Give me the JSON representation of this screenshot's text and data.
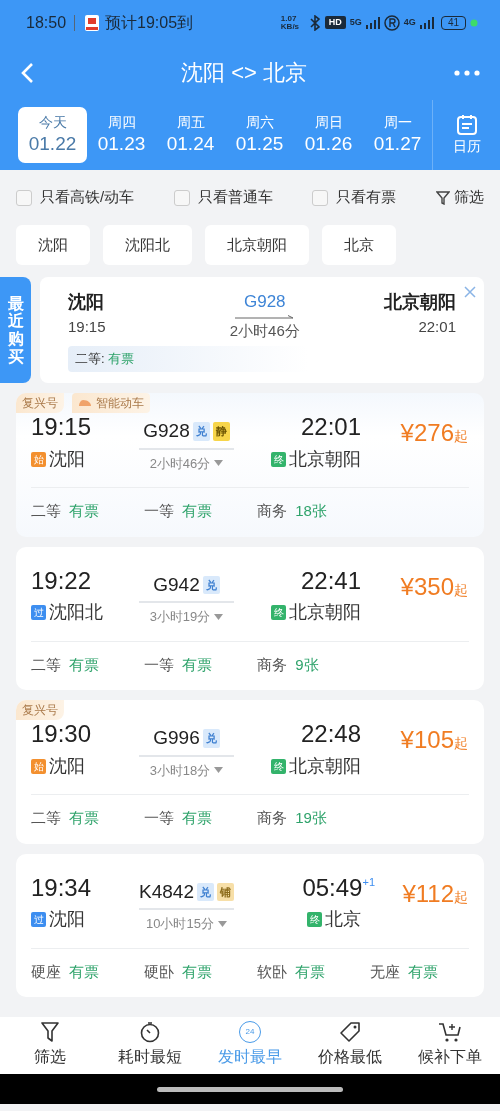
{
  "status_bar": {
    "time": "18:50",
    "notification": "预计19:05到",
    "net_speed": "1.07 KB/s",
    "hd": "HD",
    "network_1": "5G",
    "network_2": "4G",
    "battery": "41"
  },
  "header": {
    "title": "沈阳 <> 北京"
  },
  "dates": [
    {
      "weekday": "今天",
      "date": "01.22",
      "selected": true
    },
    {
      "weekday": "周四",
      "date": "01.23",
      "selected": false
    },
    {
      "weekday": "周五",
      "date": "01.24",
      "selected": false
    },
    {
      "weekday": "周六",
      "date": "01.25",
      "selected": false
    },
    {
      "weekday": "周日",
      "date": "01.26",
      "selected": false
    },
    {
      "weekday": "周一",
      "date": "01.27",
      "selected": false
    }
  ],
  "calendar": {
    "label": "日历"
  },
  "filters": [
    {
      "label": "只看高铁/动车",
      "checked": false
    },
    {
      "label": "只看普通车",
      "checked": false
    },
    {
      "label": "只看有票",
      "checked": false
    }
  ],
  "filter_button": {
    "label": "筛选"
  },
  "stations": [
    "沈阳",
    "沈阳北",
    "北京朝阳",
    "北京"
  ],
  "recent": {
    "tab": "最近购买",
    "from": "沈阳",
    "dep_time": "19:15",
    "train": "G928",
    "duration": "2小时46分",
    "to": "北京朝阳",
    "arr_time": "22:01",
    "seat_class": "二等:",
    "seat_status": "有票"
  },
  "trains": [
    {
      "tags": [
        {
          "label": "复兴号",
          "kind": "plain"
        },
        {
          "label": "智能动车",
          "kind": "smart"
        }
      ],
      "dep_time": "19:15",
      "dep_badge": {
        "text": "始",
        "kind": "start"
      },
      "dep_station": "沈阳",
      "number": "G928",
      "badges": [
        {
          "text": "兑",
          "kind": "exchange"
        },
        {
          "text": "静",
          "kind": "quiet"
        }
      ],
      "duration": "2小时46分",
      "arr_time": "22:01",
      "arr_badge": {
        "text": "终",
        "kind": "end"
      },
      "arr_station": "北京朝阳",
      "price": "¥276",
      "price_suffix": "起",
      "seats": [
        {
          "class": "二等",
          "status": "有票"
        },
        {
          "class": "一等",
          "status": "有票"
        },
        {
          "class": "商务",
          "status": "18张"
        }
      ]
    },
    {
      "dep_time": "19:22",
      "dep_badge": {
        "text": "过",
        "kind": "pass"
      },
      "dep_station": "沈阳北",
      "number": "G942",
      "badges": [
        {
          "text": "兑",
          "kind": "exchange"
        }
      ],
      "duration": "3小时19分",
      "arr_time": "22:41",
      "arr_badge": {
        "text": "终",
        "kind": "end"
      },
      "arr_station": "北京朝阳",
      "price": "¥350",
      "price_suffix": "起",
      "seats": [
        {
          "class": "二等",
          "status": "有票"
        },
        {
          "class": "一等",
          "status": "有票"
        },
        {
          "class": "商务",
          "status": "9张"
        }
      ]
    },
    {
      "tags": [
        {
          "label": "复兴号",
          "kind": "plain"
        }
      ],
      "dep_time": "19:30",
      "dep_badge": {
        "text": "始",
        "kind": "start"
      },
      "dep_station": "沈阳",
      "number": "G996",
      "badges": [
        {
          "text": "兑",
          "kind": "exchange"
        }
      ],
      "duration": "3小时18分",
      "arr_time": "22:48",
      "arr_badge": {
        "text": "终",
        "kind": "end"
      },
      "arr_station": "北京朝阳",
      "price": "¥105",
      "price_suffix": "起",
      "seats": [
        {
          "class": "二等",
          "status": "有票"
        },
        {
          "class": "一等",
          "status": "有票"
        },
        {
          "class": "商务",
          "status": "19张"
        }
      ]
    },
    {
      "dep_time": "19:34",
      "dep_badge": {
        "text": "过",
        "kind": "pass"
      },
      "dep_station": "沈阳",
      "number": "K4842",
      "badges": [
        {
          "text": "兑",
          "kind": "exchange"
        },
        {
          "text": "铺",
          "kind": "berth"
        }
      ],
      "duration": "10小时15分",
      "arr_time": "05:49",
      "day_offset": "+1",
      "arr_badge": {
        "text": "终",
        "kind": "end"
      },
      "arr_station": "北京",
      "price": "¥112",
      "price_suffix": "起",
      "seats": [
        {
          "class": "硬座",
          "status": "有票"
        },
        {
          "class": "硬卧",
          "status": "有票"
        },
        {
          "class": "软卧",
          "status": "有票"
        },
        {
          "class": "无座",
          "status": "有票"
        }
      ]
    }
  ],
  "bottom_nav": [
    {
      "label": "筛选",
      "kind": "filter",
      "selected": false
    },
    {
      "label": "耗时最短",
      "kind": "timer",
      "selected": false
    },
    {
      "label": "发时最早",
      "kind": "clock24",
      "icon_text": "24",
      "selected": true
    },
    {
      "label": "价格最低",
      "kind": "tag",
      "selected": false
    },
    {
      "label": "候补下单",
      "kind": "cart",
      "selected": false
    }
  ]
}
